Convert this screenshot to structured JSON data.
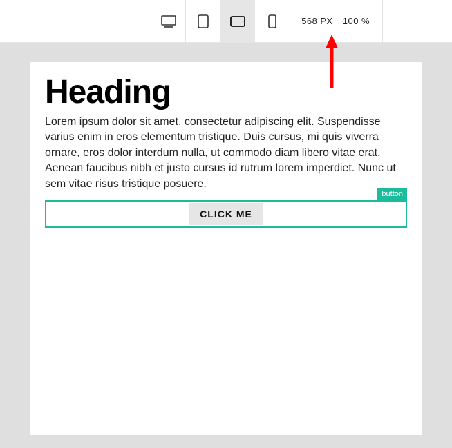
{
  "toolbar": {
    "width_value": "568",
    "width_unit": "PX",
    "zoom_value": "100",
    "zoom_unit": "%"
  },
  "devices": {
    "desktop": "desktop",
    "tablet_portrait": "tablet-portrait",
    "tablet_landscape": "tablet-landscape",
    "phone": "phone",
    "active": "tablet_landscape"
  },
  "content": {
    "heading": "Heading",
    "paragraph": "Lorem ipsum dolor sit amet, consectetur adipiscing elit. Suspendisse varius enim in eros elementum tristique. Duis cursus, mi quis viverra ornare, eros dolor interdum nulla, ut commodo diam libero vitae erat. Aenean faucibus nibh et justo cursus id rutrum lorem imperdiet. Nunc ut sem vitae risus tristique posuere."
  },
  "selected_element": {
    "tag_label": "button",
    "button_label": "CLICK ME"
  },
  "colors": {
    "accent": "#1abc9c",
    "annotation": "#ff0000"
  }
}
